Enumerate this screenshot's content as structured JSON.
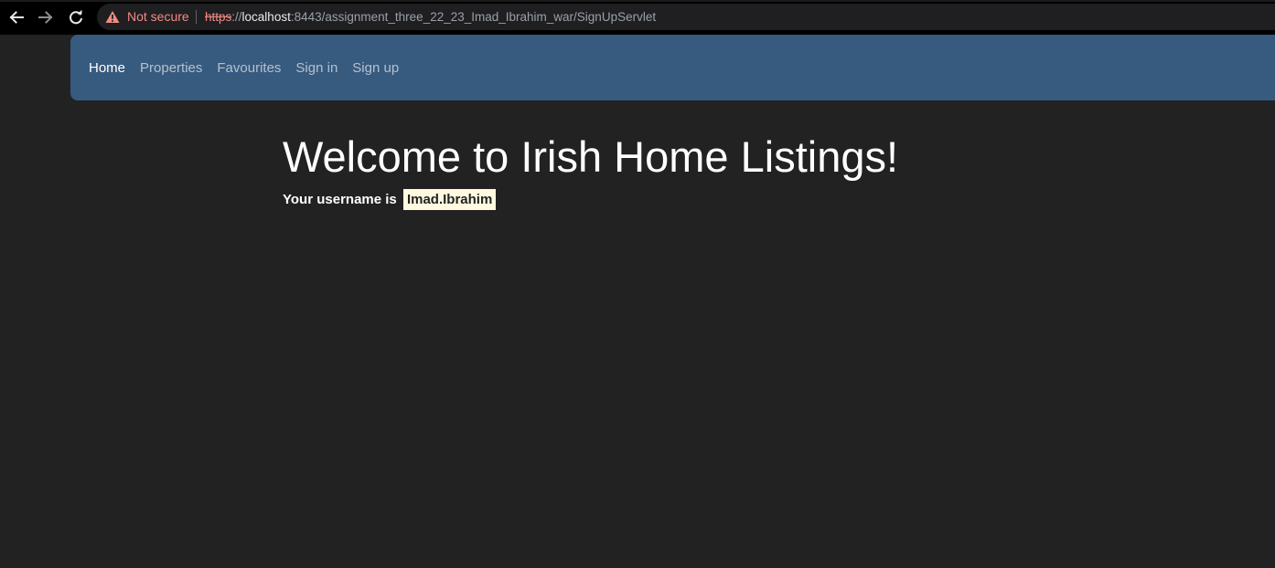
{
  "browser": {
    "back_icon": "arrow-left-icon",
    "forward_icon": "arrow-right-icon",
    "reload_icon": "reload-icon",
    "security_icon": "warning-triangle-icon",
    "security_label": "Not secure",
    "url": {
      "scheme": "https",
      "separator": "://",
      "host": "localhost",
      "rest": ":8443/assignment_three_22_23_Imad_Ibrahim_war/SignUpServlet"
    }
  },
  "nav": {
    "items": [
      {
        "label": "Home",
        "active": true
      },
      {
        "label": "Properties",
        "active": false
      },
      {
        "label": "Favourites",
        "active": false
      },
      {
        "label": "Sign in",
        "active": false
      },
      {
        "label": "Sign up",
        "active": false
      }
    ]
  },
  "main": {
    "title": "Welcome to Irish Home Listings!",
    "username_prefix": "Your username is",
    "username": "Imad.Ibrahim"
  },
  "colors": {
    "background": "#222222",
    "navbar": "#375a7f",
    "warning": "#f28b82",
    "username_highlight": "#fff9e0"
  }
}
